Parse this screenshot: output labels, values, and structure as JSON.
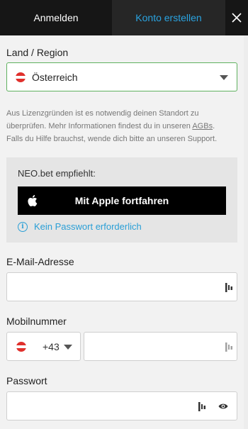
{
  "tabs": {
    "login_label": "Anmelden",
    "register_label": "Konto erstellen",
    "close_glyph": "✕"
  },
  "country": {
    "label": "Land / Region",
    "value": "Österreich",
    "flag_icon": "austria-flag-icon"
  },
  "info_text": {
    "line1": "Aus Lizenzgründen ist es notwendig deinen Standort zu",
    "line2_before": "überprüfen. Mehr Informationen findest du in unseren ",
    "agb_link": "AGBs",
    "line2_after": ".",
    "line3": "Falls du Hilfe brauchst, wende dich bitte an unseren Support."
  },
  "recommend": {
    "title": "NEO.bet empfiehlt:",
    "apple_button": "Mit Apple fortfahren",
    "no_password": "Kein Passwort erforderlich"
  },
  "email": {
    "label": "E-Mail-Adresse",
    "value": "",
    "placeholder": ""
  },
  "phone": {
    "label": "Mobilnummer",
    "prefix": "+43",
    "value": "",
    "placeholder": ""
  },
  "password": {
    "label": "Passwort",
    "value": "",
    "placeholder": ""
  },
  "colors": {
    "tab_active_text": "#2aa3e0",
    "select_border": "#5fb15f",
    "link_blue": "#2a9fd6",
    "header_bg": "#1f1f1f"
  }
}
